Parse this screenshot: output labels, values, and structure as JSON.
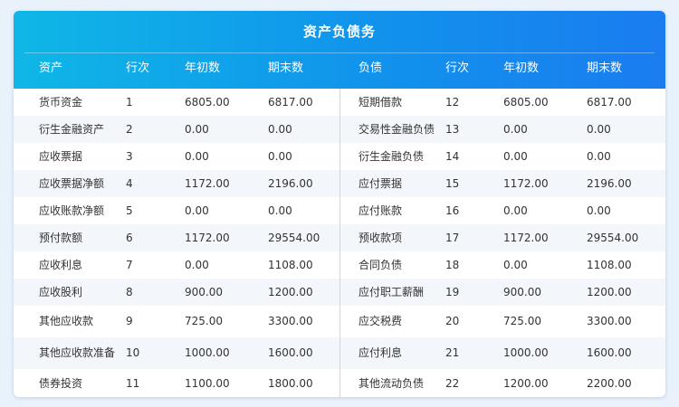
{
  "title": "资产负债务",
  "columns": [
    "资产",
    "行次",
    "年初数",
    "期末数",
    "负债",
    "行次",
    "年初数",
    "期末数"
  ],
  "rows": [
    [
      "货币资金",
      "1",
      "6805.00",
      "6817.00",
      "短期借款",
      "12",
      "6805.00",
      "6817.00"
    ],
    [
      "衍生金融资产",
      "2",
      "0.00",
      "0.00",
      "交易性金融负债",
      "13",
      "0.00",
      "0.00"
    ],
    [
      "应收票据",
      "3",
      "0.00",
      "0.00",
      "衍生金融负债",
      "14",
      "0.00",
      "0.00"
    ],
    [
      "应收票据净额",
      "4",
      "1172.00",
      "2196.00",
      "应付票据",
      "15",
      "1172.00",
      "2196.00"
    ],
    [
      "应收账款净额",
      "5",
      "0.00",
      "0.00",
      "应付账款",
      "16",
      "0.00",
      "0.00"
    ],
    [
      "预付款额",
      "6",
      "1172.00",
      "29554.00",
      "预收款项",
      "17",
      "1172.00",
      "29554.00"
    ],
    [
      "应收利息",
      "7",
      "0.00",
      "1108.00",
      "合同负债",
      "18",
      "0.00",
      "1108.00"
    ],
    [
      "应收股利",
      "8",
      "900.00",
      "1200.00",
      "应付职工薪酬",
      "19",
      "900.00",
      "1200.00"
    ],
    [
      "其他应收款",
      "9",
      "725.00",
      "3300.00",
      "应交税费",
      "20",
      "725.00",
      "3300.00"
    ],
    [
      "其他应收款准备",
      "10",
      "1000.00",
      "1600.00",
      "应付利息",
      "21",
      "1000.00",
      "1600.00"
    ],
    [
      "债券投资",
      "11",
      "1100.00",
      "1800.00",
      "其他流动负债",
      "22",
      "1200.00",
      "2200.00"
    ]
  ]
}
